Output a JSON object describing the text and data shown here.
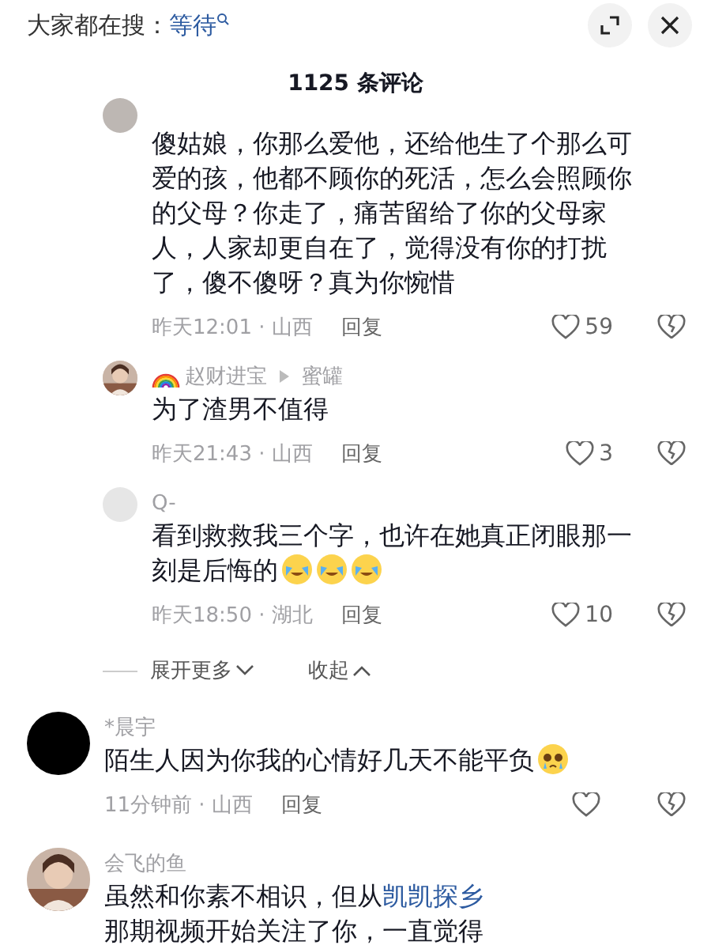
{
  "search_bar": {
    "label": "大家都在搜：",
    "keyword": "等待"
  },
  "title": "1125 条评论",
  "comments": [
    {
      "kind": "reply",
      "avatar": {
        "kind": "cut"
      },
      "text": "傻姑娘，你那么爱他，还给他生了个那么可爱的孩，他都不顾你的死活，怎么会照顾你的父母？你走了，痛苦留给了你的父母家人，人家却更自在了，觉得没有你的打扰了，傻不傻呀？真为你惋惜",
      "time": "昨天12:01 · 山西",
      "reply": "回复",
      "likes": "59"
    },
    {
      "kind": "reply",
      "author": "赵财进宝",
      "badge": {
        "kind": "rainbow"
      },
      "reply_to": "蜜罐",
      "text": "为了渣男不值得",
      "time": "昨天21:43 · 山西",
      "reply": "回复",
      "likes": "3"
    },
    {
      "kind": "reply",
      "avatar": {
        "kind": "blank"
      },
      "author": "Q-",
      "text": "看到救救我三个字，也许在她真正闭眼那一刻是后悔的",
      "emojis": [
        {
          "kind": "cry"
        },
        {
          "kind": "cry"
        },
        {
          "kind": "cry"
        }
      ],
      "time": "昨天18:50 · 湖北",
      "reply": "回复",
      "likes": "10"
    },
    {
      "kind": "more",
      "expand": "展开更多",
      "collapse": "收起"
    },
    {
      "kind": "top",
      "avatar": {
        "kind": "black"
      },
      "author": "*晨宇",
      "text": "陌生人因为你我的心情好几天不能平负",
      "emojis": [
        {
          "kind": "tear"
        }
      ],
      "time": "11分钟前 · 山西",
      "reply": "回复"
    },
    {
      "kind": "top",
      "author": "会飞的鱼",
      "text": "虽然和你素不相识，但从",
      "link": "凯凯探乡",
      "text_after": "那期视频开始关注了你，一直觉得"
    }
  ]
}
